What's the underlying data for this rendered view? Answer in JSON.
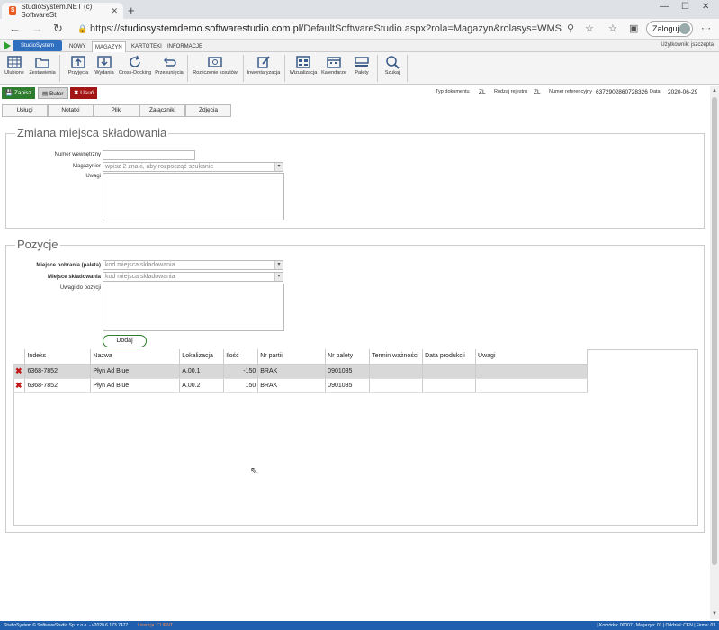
{
  "browser": {
    "tab_title": "StudioSystem.NET (c) SoftwareSt",
    "url_domain": "studiosystemdemo.softwarestudio.com.pl",
    "url_path": "/DefaultSoftwareStudio.aspx?rola=Magazyn&rolasys=WMS",
    "url_scheme": "https://",
    "login_label": "Zaloguj"
  },
  "menu": {
    "brand": "StudioSystem",
    "tabs": [
      "NOWY",
      "MAGAZYN",
      "KARTOTEKI",
      "INFORMACJE"
    ],
    "user": "Użytkownik: jszczepta"
  },
  "ribbon": [
    {
      "label": "Ulubione",
      "icon": "grid-icon"
    },
    {
      "label": "Zestawienia",
      "icon": "folder-icon"
    },
    {
      "label": "Przyjęcia",
      "icon": "upload-box-icon"
    },
    {
      "label": "Wydania",
      "icon": "download-box-icon"
    },
    {
      "label": "Cross-Docking",
      "icon": "refresh-icon"
    },
    {
      "label": "Przesunięcia",
      "icon": "undo-arrow-icon"
    },
    {
      "label": "Rozliczenie kosztów",
      "icon": "money-icon"
    },
    {
      "label": "Inwentaryzacja",
      "icon": "edit-doc-icon"
    },
    {
      "label": "Wizualizacja",
      "icon": "warehouse-icon"
    },
    {
      "label": "Kalendarze",
      "icon": "calendar-icon"
    },
    {
      "label": "Palety",
      "icon": "pallet-icon"
    },
    {
      "label": "Szukaj",
      "icon": "search-icon"
    }
  ],
  "actions": {
    "save": "Zapisz",
    "buffer": "Bufor",
    "delete": "Usuń"
  },
  "doc_meta": {
    "type_label": "Typ dokumentu",
    "type_value": "ZL",
    "register_label": "Rodzaj rejestru",
    "register_value": "ZL",
    "ref_label": "Numer referencyjny",
    "ref_value": "6372902860728326",
    "date_label": "Data",
    "date_value": "2020-06-29"
  },
  "doc_tabs": [
    "Usługi",
    "Notatki",
    "Pliki",
    "Załączniki",
    "Zdjęcia"
  ],
  "section1": {
    "title": "Zmiana miejsca składowania",
    "internal_no_label": "Numer wewnętrzny",
    "warehouse_label": "Magazynier",
    "warehouse_placeholder": "wpisz 2 znaki, aby rozpocząć szukanie",
    "notes_label": "Uwagi"
  },
  "section2": {
    "title": "Pozycje",
    "from_label": "Miejsce pobrania (paleta)",
    "from_placeholder": "kod miejsca składowania",
    "to_label": "Miejsce składowania",
    "to_placeholder": "kod miejsca składowania",
    "notes_label": "Uwagi do pozycji",
    "add_button": "Dodaj"
  },
  "grid": {
    "columns": [
      "Indeks",
      "Nazwa",
      "Lokalizacja",
      "Ilość",
      "Nr partii",
      "Nr palety",
      "Termin ważności",
      "Data produkcji",
      "Uwagi"
    ],
    "rows": [
      [
        "6368-7852",
        "Płyn Ad Blue",
        "A.00.1",
        "-150",
        "BRAK",
        "0901035",
        "",
        "",
        ""
      ],
      [
        "6368-7852",
        "Płyn Ad Blue",
        "A.00.2",
        "150",
        "BRAK",
        "0901035",
        "",
        "",
        ""
      ]
    ]
  },
  "status": {
    "left": "StudioSystem © SoftwareStudio Sp. z o.o. - v2020.6.173.7477",
    "license": "Licencja: CLIENT",
    "right": "| Komórka: 00007 | Magazyn: 01 | Oddział: CEN | Firma: 01"
  }
}
